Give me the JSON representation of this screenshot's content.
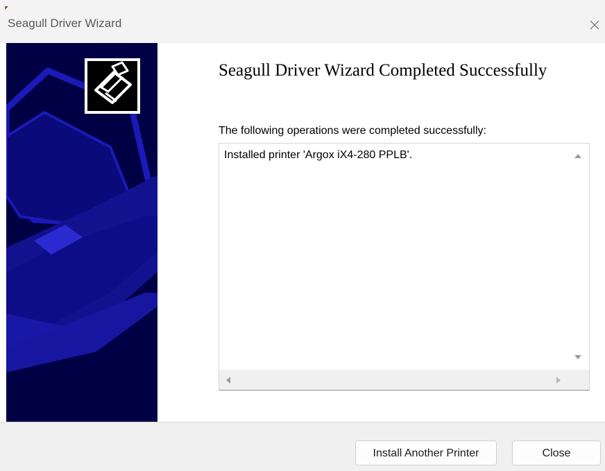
{
  "window": {
    "title": "Seagull Driver Wizard",
    "close_icon": "close-icon"
  },
  "banner": {
    "logo_icon": "printer-logo-icon",
    "background_color": "#000044",
    "accent_color": "#1a1ab8"
  },
  "content": {
    "heading": "Seagull Driver Wizard Completed Successfully",
    "subtext": "The following operations were completed successfully:",
    "results": [
      "Installed printer 'Argox iX4-280 PPLB'."
    ]
  },
  "footer": {
    "install_another_label": "Install Another Printer",
    "close_label": "Close"
  }
}
